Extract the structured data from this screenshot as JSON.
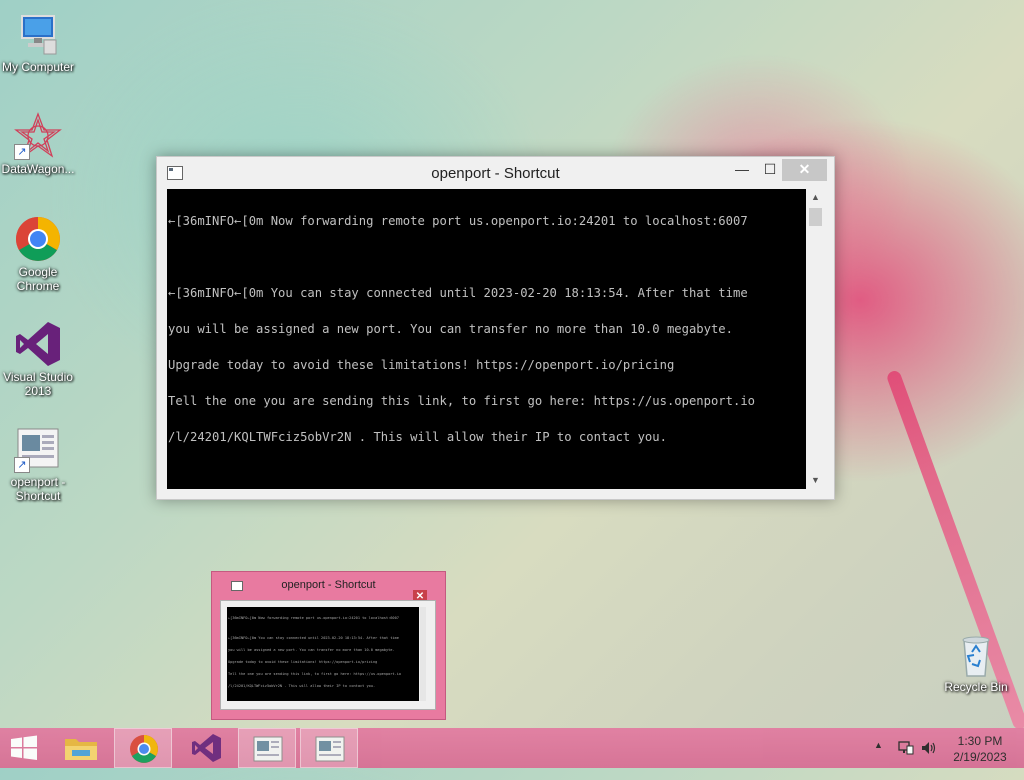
{
  "desktop": {
    "icons": [
      {
        "label": "My Computer"
      },
      {
        "label": "DataWagon..."
      },
      {
        "label": "Google Chrome"
      },
      {
        "label": "Visual Studio 2013"
      },
      {
        "label": "openport - Shortcut"
      },
      {
        "label": "Recycle Bin"
      }
    ]
  },
  "window": {
    "title": "openport - Shortcut",
    "minimize": "—",
    "maximize": "☐",
    "close": "✕",
    "console_lines": [
      "←[36mINFO←[0m Now forwarding remote port us.openport.io:24201 to localhost:6007",
      "",
      "←[36mINFO←[0m You can stay connected until 2023-02-20 18:13:54. After that time",
      "you will be assigned a new port. You can transfer no more than 10.0 megabyte.",
      "Upgrade today to avoid these limitations! https://openport.io/pricing",
      "Tell the one you are sending this link, to first go here: https://us.openport.io",
      "/l/24201/KQLTWFciz5obVr2N . This will allow their IP to contact you."
    ]
  },
  "preview": {
    "title": "openport - Shortcut",
    "close": "✕"
  },
  "taskbar": {
    "items": [
      "start",
      "file-explorer",
      "chrome",
      "visual-studio",
      "openport-1",
      "openport-2"
    ],
    "clock_time": "1:30 PM",
    "clock_date": "2/19/2023",
    "tray_chevron": "▲"
  },
  "colors": {
    "taskbar": "#df779c",
    "console_bg": "#000000",
    "console_fg": "#c0c0c0"
  }
}
